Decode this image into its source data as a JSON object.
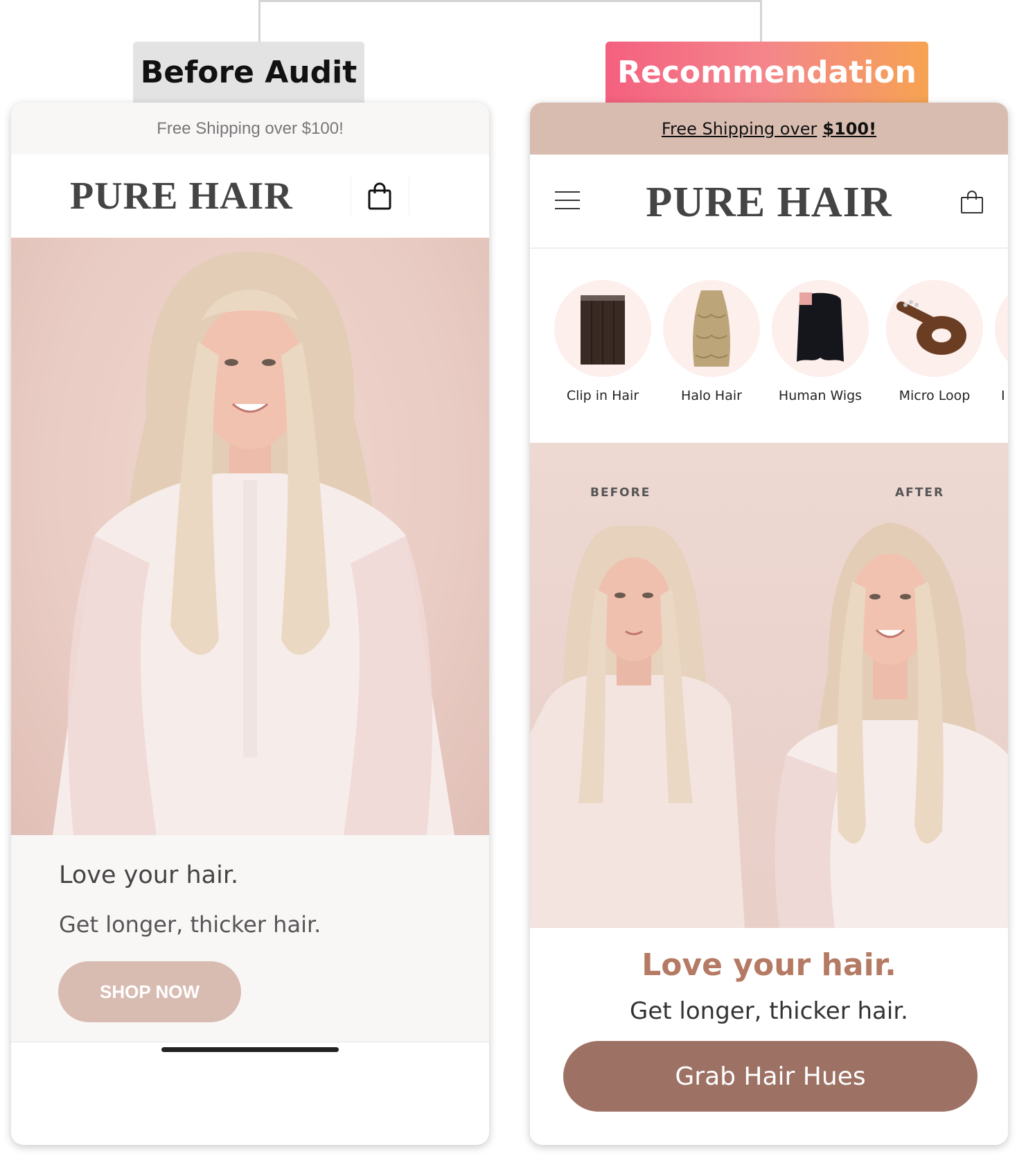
{
  "tags": {
    "before": "Before Audit",
    "recommendation": "Recommendation"
  },
  "before": {
    "shipping": "Free Shipping over $100!",
    "logo": "PURE HAIR",
    "headline": "Love your hair.",
    "subheadline": "Get longer, thicker hair.",
    "cta": "SHOP NOW"
  },
  "recommendation": {
    "shipping_prefix": "Free Shipping over",
    "shipping_amount": "$100!",
    "logo": "PURE HAIR",
    "categories": [
      {
        "label": "Clip in Hair",
        "icon": "clip-in-hair-image"
      },
      {
        "label": "Halo Hair",
        "icon": "halo-hair-image"
      },
      {
        "label": "Human Wigs",
        "icon": "human-wig-image"
      },
      {
        "label": "Micro Loop",
        "icon": "micro-loop-image"
      },
      {
        "label": "I",
        "icon": "partial-category-image"
      }
    ],
    "before_label": "BEFORE",
    "after_label": "AFTER",
    "headline": "Love your hair.",
    "subheadline": "Get longer, thicker hair.",
    "cta": "Grab Hair Hues"
  },
  "colors": {
    "gradient_start": "#f4607f",
    "gradient_end": "#f6a352",
    "headline_accent": "#b47a64",
    "cta_before": "#d8bcb2",
    "cta_after": "#9d7264",
    "shipping_bar_after": "#d8bcb0"
  }
}
